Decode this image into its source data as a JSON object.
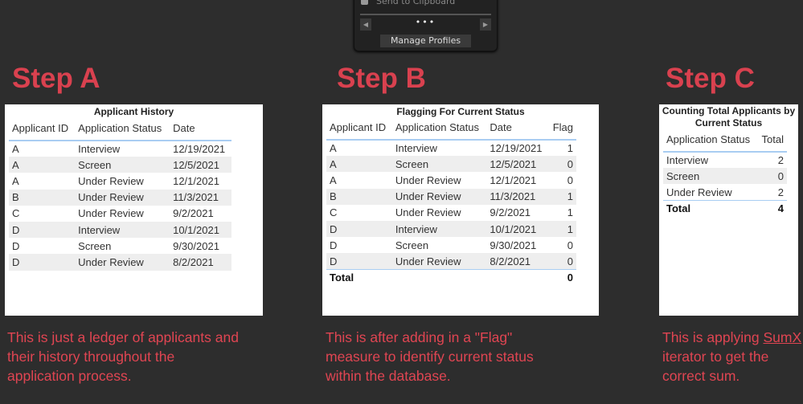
{
  "popup": {
    "clipboard_label": "Send to Clipboard",
    "dots": "•••",
    "manage_profiles": "Manage Profiles"
  },
  "stepA": {
    "heading": "Step A",
    "table_title": "Applicant History",
    "columns": [
      "Applicant ID",
      "Application Status",
      "Date"
    ],
    "rows": [
      [
        "A",
        "Interview",
        "12/19/2021"
      ],
      [
        "A",
        "Screen",
        "12/5/2021"
      ],
      [
        "A",
        "Under Review",
        "12/1/2021"
      ],
      [
        "B",
        "Under Review",
        "11/3/2021"
      ],
      [
        "C",
        "Under Review",
        "9/2/2021"
      ],
      [
        "D",
        "Interview",
        "10/1/2021"
      ],
      [
        "D",
        "Screen",
        "9/30/2021"
      ],
      [
        "D",
        "Under Review",
        "8/2/2021"
      ]
    ],
    "caption": "This is just a ledger of applicants and their history throughout the application process."
  },
  "stepB": {
    "heading": "Step B",
    "table_title": "Flagging For Current Status",
    "columns": [
      "Applicant ID",
      "Application Status",
      "Date",
      "Flag"
    ],
    "rows": [
      [
        "A",
        "Interview",
        "12/19/2021",
        "1"
      ],
      [
        "A",
        "Screen",
        "12/5/2021",
        "0"
      ],
      [
        "A",
        "Under Review",
        "12/1/2021",
        "0"
      ],
      [
        "B",
        "Under Review",
        "11/3/2021",
        "1"
      ],
      [
        "C",
        "Under Review",
        "9/2/2021",
        "1"
      ],
      [
        "D",
        "Interview",
        "10/1/2021",
        "1"
      ],
      [
        "D",
        "Screen",
        "9/30/2021",
        "0"
      ],
      [
        "D",
        "Under Review",
        "8/2/2021",
        "0"
      ]
    ],
    "total_label": "Total",
    "total_value": "0",
    "caption": "This is after adding in a \"Flag\" measure to identify current status within the database."
  },
  "stepC": {
    "heading": "Step C",
    "table_title": "Counting Total Applicants by Current Status",
    "columns": [
      "Application Status",
      "Total"
    ],
    "rows": [
      [
        "Interview",
        "2"
      ],
      [
        "Screen",
        "0"
      ],
      [
        "Under Review",
        "2"
      ]
    ],
    "total_label": "Total",
    "total_value": "4",
    "caption_pre": "This is applying ",
    "caption_link": "SumX",
    "caption_post": " iterator to get the correct sum."
  },
  "colors": {
    "background": "#2d2d2d",
    "accent_red": "#d9414f",
    "header_rule": "#a9cdf2"
  }
}
